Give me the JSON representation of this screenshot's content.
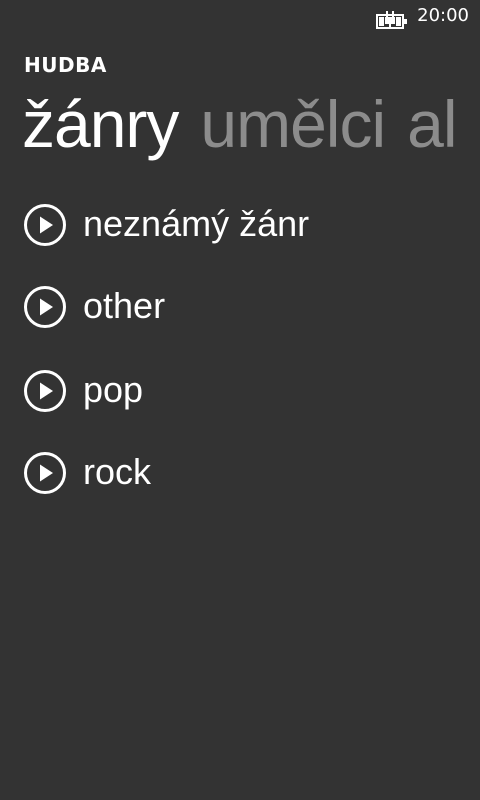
{
  "status_bar": {
    "time": "20:00",
    "battery_icon": "battery-charging-icon"
  },
  "app": {
    "title": "HUDBA"
  },
  "pivot": {
    "items": [
      {
        "label": "žánry",
        "active": true
      },
      {
        "label": "umělci",
        "active": false
      },
      {
        "label": "al",
        "active": false
      }
    ]
  },
  "genres": [
    {
      "label": "neznámý žánr",
      "icon": "play-icon"
    },
    {
      "label": "other",
      "icon": "play-icon"
    },
    {
      "label": "pop",
      "icon": "play-icon"
    },
    {
      "label": "rock",
      "icon": "play-icon"
    }
  ],
  "colors": {
    "background": "#333333",
    "text": "#ffffff",
    "inactive_header": "#8c8c8c"
  }
}
